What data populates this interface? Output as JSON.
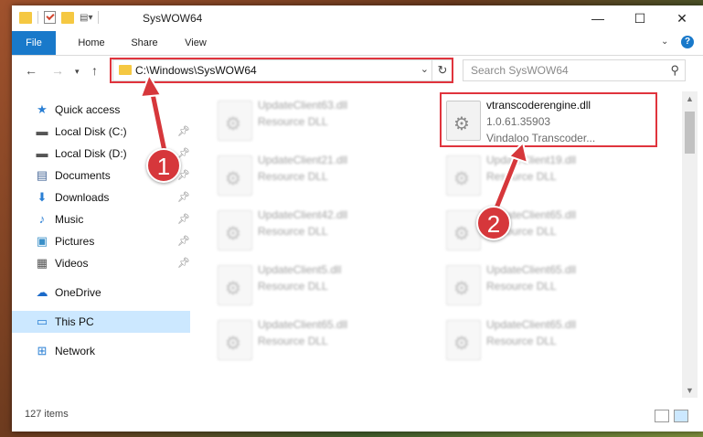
{
  "window": {
    "title": "SysWOW64",
    "controls": {
      "minimize": "—",
      "maximize": "☐",
      "close": "✕"
    }
  },
  "ribbon": {
    "tabs": [
      "File",
      "Home",
      "Share",
      "View"
    ],
    "help": "?"
  },
  "address": {
    "path": "C:\\Windows\\SysWOW64",
    "search_placeholder": "Search SysWOW64"
  },
  "sidebar": {
    "items": [
      {
        "label": "Quick access",
        "icon": "star-icon",
        "pinned": false
      },
      {
        "label": "Local Disk (C:)",
        "icon": "drive-icon",
        "pinned": true
      },
      {
        "label": "Local Disk (D:)",
        "icon": "drive-icon",
        "pinned": true
      },
      {
        "label": "Documents",
        "icon": "documents-icon",
        "pinned": true
      },
      {
        "label": "Downloads",
        "icon": "downloads-icon",
        "pinned": true
      },
      {
        "label": "Music",
        "icon": "music-icon",
        "pinned": true
      },
      {
        "label": "Pictures",
        "icon": "pictures-icon",
        "pinned": true
      },
      {
        "label": "Videos",
        "icon": "videos-icon",
        "pinned": true
      },
      {
        "label": "OneDrive",
        "icon": "onedrive-icon",
        "pinned": false
      },
      {
        "label": "This PC",
        "icon": "pc-icon",
        "pinned": false,
        "selected": true
      },
      {
        "label": "Network",
        "icon": "network-icon",
        "pinned": false
      }
    ]
  },
  "files": [
    {
      "name": "UpdateClient63.dll",
      "type": "Resource DLL",
      "blurred": true
    },
    {
      "name": "vtranscoderengine.dll",
      "version": "1.0.61.35903",
      "type": "Vindaloo Transcoder...",
      "blurred": false
    },
    {
      "name": "UpdateClient21.dll",
      "type": "Resource DLL",
      "blurred": true
    },
    {
      "name": "UpdateClient19.dll",
      "type": "Resource DLL",
      "blurred": true
    },
    {
      "name": "UpdateClient42.dll",
      "type": "Resource DLL",
      "blurred": true
    },
    {
      "name": "UpdateClient65.dll",
      "type": "Resource DLL",
      "blurred": true
    },
    {
      "name": "UpdateClient5.dll",
      "type": "Resource DLL",
      "blurred": true
    },
    {
      "name": "UpdateClient65.dll",
      "type": "Resource DLL",
      "blurred": true
    },
    {
      "name": "UpdateClient65.dll",
      "type": "Resource DLL",
      "blurred": true
    },
    {
      "name": "UpdateClient65.dll",
      "type": "Resource DLL",
      "blurred": true
    }
  ],
  "status": {
    "item_count": "127 items"
  },
  "callouts": [
    "1",
    "2"
  ],
  "colors": {
    "accent": "#1979ca",
    "highlight": "#e0343d",
    "callout": "#d6373b",
    "selected": "#cce8ff"
  }
}
